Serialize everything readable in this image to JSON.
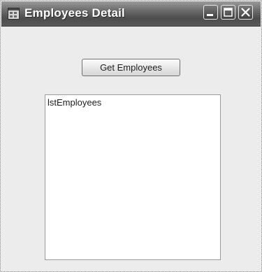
{
  "window": {
    "title": "Employees Detail",
    "title_icon": "app-window-icon"
  },
  "titlebar_buttons": {
    "minimize_icon": "minimize-icon",
    "maximize_icon": "maximize-icon",
    "close_icon": "close-icon"
  },
  "form": {
    "get_employees_label": "Get Employees",
    "listbox": {
      "items": [
        "lstEmployees"
      ]
    }
  },
  "colors": {
    "titlebar": "#5a5a5a",
    "window_body": "#ececec",
    "listbox_background": "#ffffff"
  }
}
